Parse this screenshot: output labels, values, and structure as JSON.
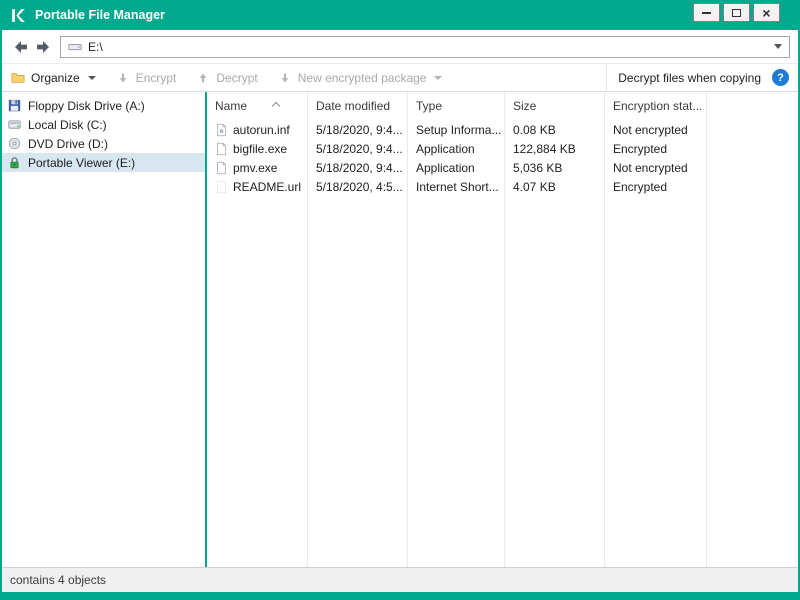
{
  "colors": {
    "accent": "#00a88e",
    "selection": "#d8e6f0",
    "disabled_text": "#a8a8a8",
    "help_blue": "#1f7cd6"
  },
  "window": {
    "title": "Portable File Manager",
    "controls": {
      "minimize": "minimize",
      "maximize": "maximize",
      "close": "close"
    }
  },
  "nav": {
    "address": "E:\\"
  },
  "toolbar": {
    "organize_label": "Organize",
    "encrypt_label": "Encrypt",
    "decrypt_label": "Decrypt",
    "new_package_label": "New encrypted package",
    "decrypt_when_copying_label": "Decrypt files when copying",
    "help_glyph": "?"
  },
  "sidebar": {
    "items": [
      {
        "label": "Floppy Disk Drive (A:)",
        "icon": "floppy-drive-icon",
        "selected": false
      },
      {
        "label": "Local Disk (C:)",
        "icon": "hard-disk-icon",
        "selected": false
      },
      {
        "label": "DVD Drive (D:)",
        "icon": "dvd-disc-icon",
        "selected": false
      },
      {
        "label": "Portable Viewer (E:)",
        "icon": "green-lock-icon",
        "selected": true
      }
    ]
  },
  "file_list": {
    "columns": [
      {
        "label": "Name",
        "sorted": "ascending"
      },
      {
        "label": "Date modified"
      },
      {
        "label": "Type"
      },
      {
        "label": "Size"
      },
      {
        "label": "Encryption stat..."
      }
    ],
    "rows": [
      {
        "name": "autorun.inf",
        "date_modified": "5/18/2020, 9:4...",
        "type": "Setup Informa...",
        "size": "0.08 KB",
        "encryption_status": "Not encrypted",
        "icon": "setup-file-icon"
      },
      {
        "name": "bigfile.exe",
        "date_modified": "5/18/2020, 9:4...",
        "type": "Application",
        "size": "122,884 KB",
        "encryption_status": "Encrypted",
        "icon": "application-file-icon"
      },
      {
        "name": "pmv.exe",
        "date_modified": "5/18/2020, 9:4...",
        "type": "Application",
        "size": "5,036 KB",
        "encryption_status": "Not encrypted",
        "icon": "application-file-icon"
      },
      {
        "name": "README.url",
        "date_modified": "5/18/2020, 4:5...",
        "type": "Internet Short...",
        "size": "4.07 KB",
        "encryption_status": "Encrypted",
        "icon": "url-file-icon"
      }
    ]
  },
  "status_bar": {
    "text": "contains 4 objects"
  }
}
